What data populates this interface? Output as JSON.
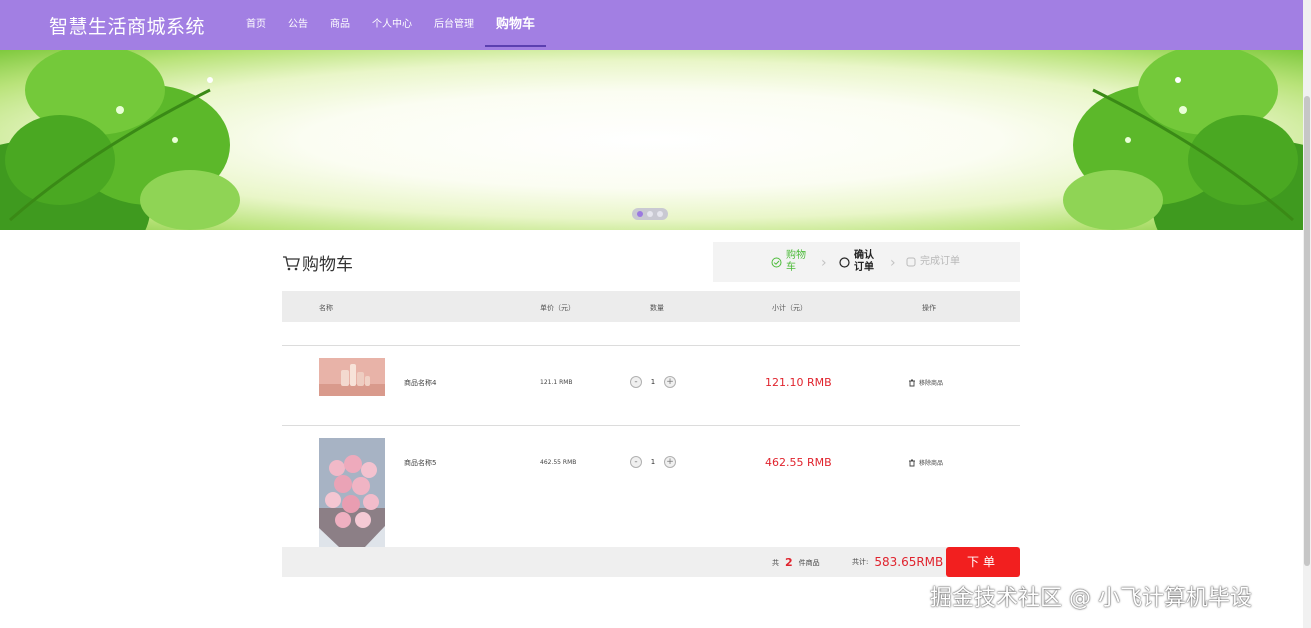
{
  "header": {
    "brand": "智慧生活商城系统",
    "nav": [
      "首页",
      "公告",
      "商品",
      "个人中心",
      "后台管理",
      "购物车"
    ],
    "active_index": 5
  },
  "banner": {
    "slides": 3,
    "active_slide": 0
  },
  "cart": {
    "title": "购物车",
    "steps": [
      {
        "label": "购物车",
        "state": "done"
      },
      {
        "label": "确认订单",
        "state": "current"
      },
      {
        "label": "完成订单",
        "state": "pending"
      }
    ],
    "columns": [
      "名称",
      "单价（元）",
      "数量",
      "小计（元）",
      "操作"
    ],
    "items": [
      {
        "name": "商品名称4",
        "unit_price": "121.1 RMB",
        "quantity": "1",
        "subtotal": "121.10 RMB",
        "remove_label": "移除商品",
        "image": "perfume-bottles"
      },
      {
        "name": "商品名称5",
        "unit_price": "462.55 RMB",
        "quantity": "1",
        "subtotal": "462.55 RMB",
        "remove_label": "移除商品",
        "image": "pink-rose-bouquet"
      }
    ],
    "footer": {
      "count_prefix": "共",
      "count": "2",
      "count_suffix": "件商品",
      "total_label": "共计:",
      "total": "583.65RMB",
      "submit_label": "下单"
    }
  },
  "watermark": "掘金技术社区 @ 小飞计算机毕设",
  "colors": {
    "header_bg": "#a27fe3",
    "price_red": "#e0242e",
    "submit_bg": "#f21f1f",
    "step_done": "#4cbb39"
  }
}
